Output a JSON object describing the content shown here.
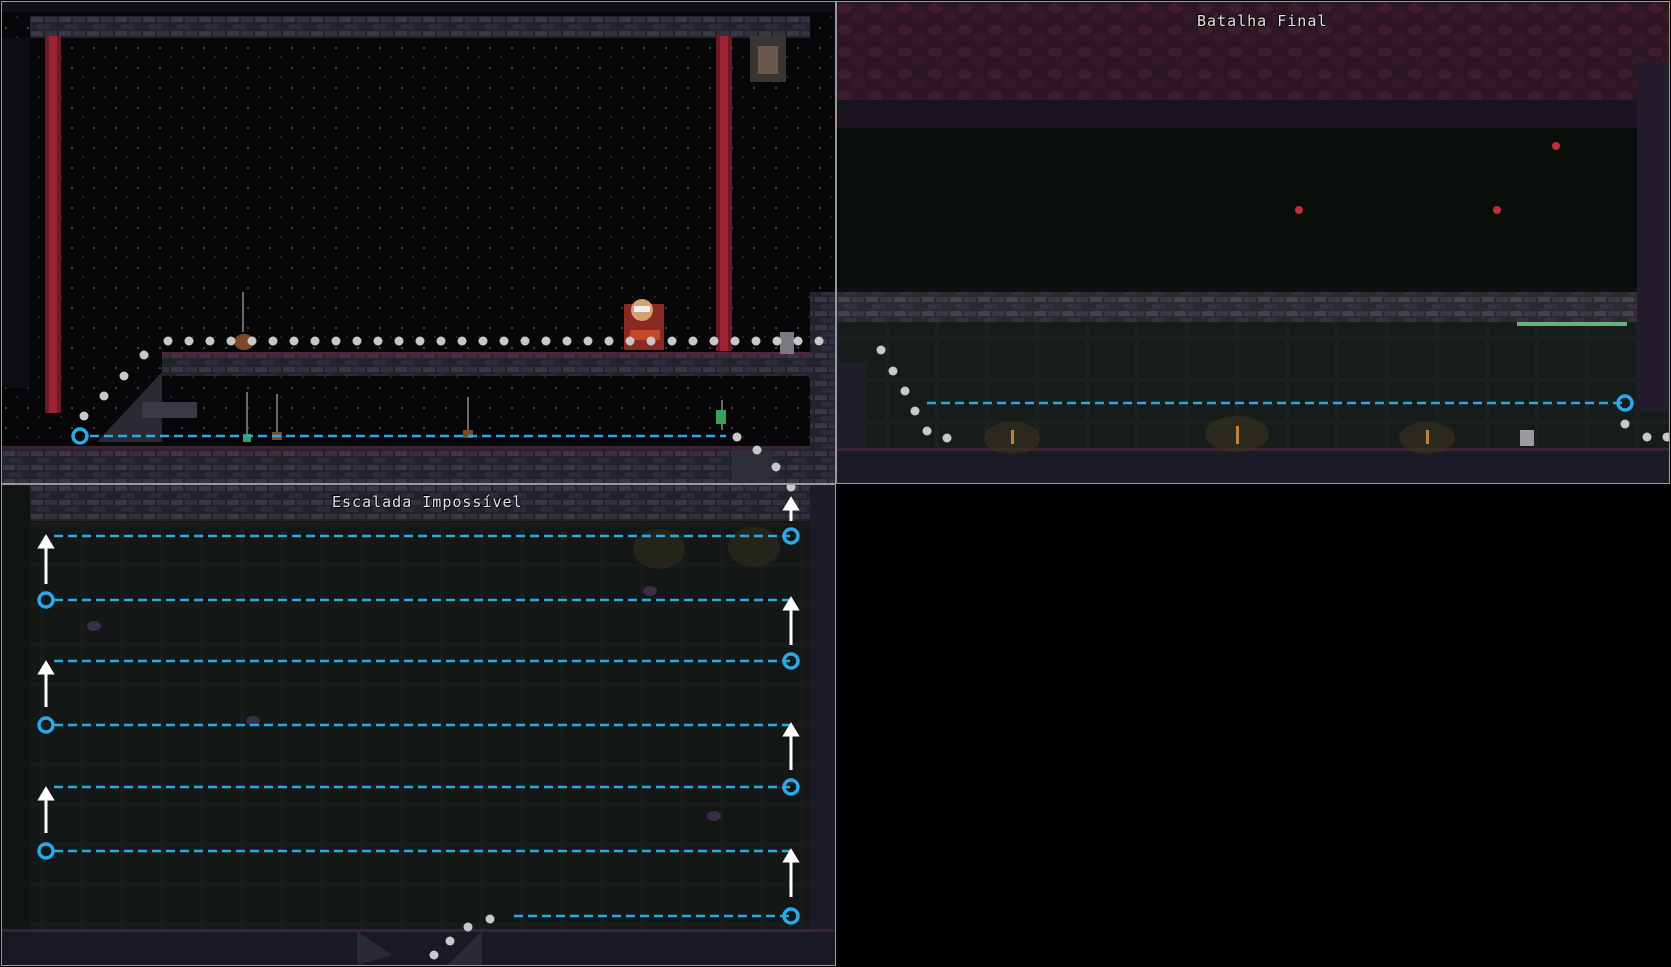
{
  "rooms": {
    "top_left": {
      "title": ""
    },
    "top_right": {
      "title": "Batalha Final"
    },
    "bottom_left": {
      "title": "Escalada Impossível"
    }
  },
  "icons": {
    "waypoint": "cyan-ring-icon",
    "climb": "up-arrow-icon",
    "jump_trail": "white-dot-icon",
    "player": "player-character-icon",
    "enemy": "bat-icon"
  },
  "colors": {
    "path": "#2aa8e8",
    "arrow": "#ffffff",
    "trail": "#c8c8c8",
    "brick": "#2c2a36",
    "ceiling_right": "#3a1e2a",
    "laser": "#b0283a"
  }
}
